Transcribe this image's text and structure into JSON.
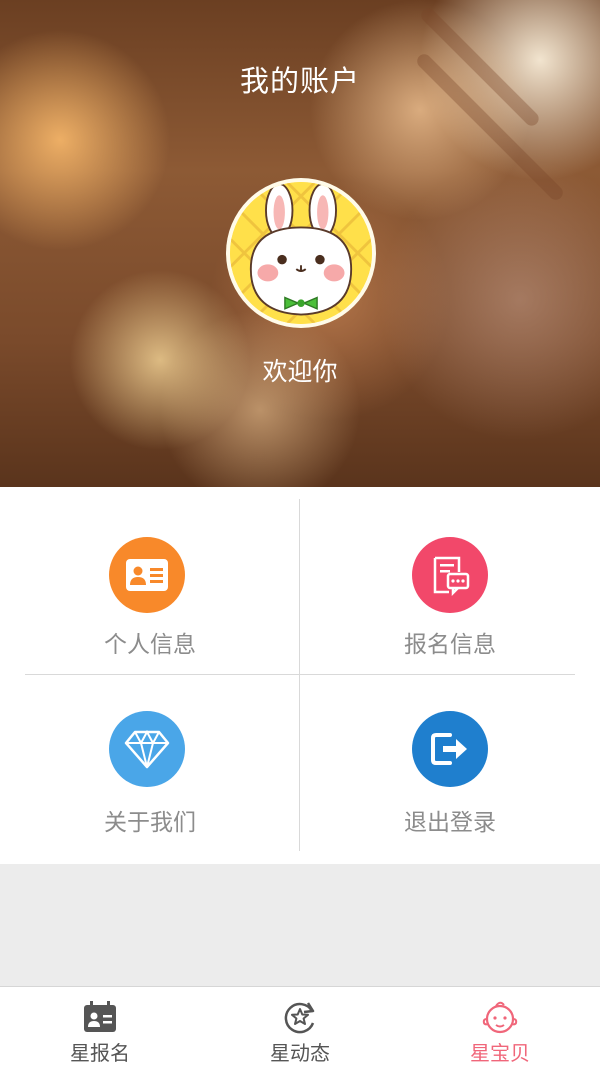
{
  "header": {
    "title": "我的账户",
    "welcome": "欢迎你"
  },
  "menu": {
    "items": [
      {
        "label": "个人信息",
        "icon": "id-card-icon",
        "color": "#f8892a"
      },
      {
        "label": "报名信息",
        "icon": "form-chat-icon",
        "color": "#f2486a"
      },
      {
        "label": "关于我们",
        "icon": "diamond-icon",
        "color": "#4aa6e8"
      },
      {
        "label": "退出登录",
        "icon": "logout-icon",
        "color": "#1f7fce"
      }
    ]
  },
  "tabbar": {
    "tabs": [
      {
        "label": "星报名",
        "icon": "calendar-contact-icon",
        "active": false
      },
      {
        "label": "星动态",
        "icon": "star-refresh-icon",
        "active": false
      },
      {
        "label": "星宝贝",
        "icon": "baby-face-icon",
        "active": true
      }
    ],
    "active_color": "#f0667a",
    "inactive_color": "#555555"
  }
}
